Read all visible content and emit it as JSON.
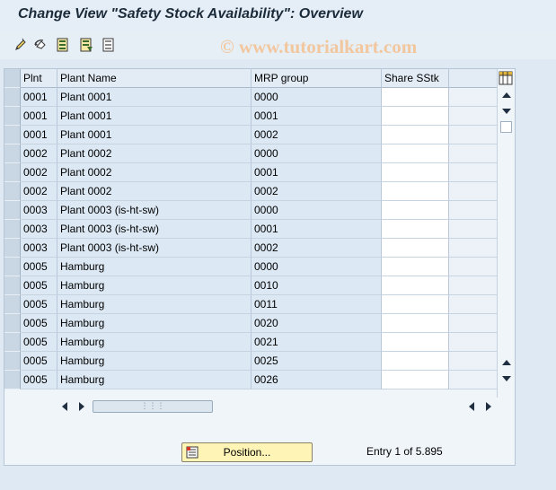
{
  "title": "Change View \"Safety Stock Availability\": Overview",
  "watermark": "© www.tutorialkart.com",
  "toolbar": {
    "icons": [
      "edit-pencil-icon",
      "undo-change-icon",
      "select-all-icon",
      "select-block-icon",
      "deselect-all-icon"
    ]
  },
  "table": {
    "columns": [
      "Plnt",
      "Plant Name",
      "MRP group",
      "Share SStk"
    ],
    "rows": [
      [
        "0001",
        "Plant 0001",
        "0000",
        ""
      ],
      [
        "0001",
        "Plant 0001",
        "0001",
        ""
      ],
      [
        "0001",
        "Plant 0001",
        "0002",
        ""
      ],
      [
        "0002",
        "Plant 0002",
        "0000",
        ""
      ],
      [
        "0002",
        "Plant 0002",
        "0001",
        ""
      ],
      [
        "0002",
        "Plant 0002",
        "0002",
        ""
      ],
      [
        "0003",
        "Plant 0003 (is-ht-sw)",
        "0000",
        ""
      ],
      [
        "0003",
        "Plant 0003 (is-ht-sw)",
        "0001",
        ""
      ],
      [
        "0003",
        "Plant 0003 (is-ht-sw)",
        "0002",
        ""
      ],
      [
        "0005",
        "Hamburg",
        "0000",
        ""
      ],
      [
        "0005",
        "Hamburg",
        "0010",
        ""
      ],
      [
        "0005",
        "Hamburg",
        "0011",
        ""
      ],
      [
        "0005",
        "Hamburg",
        "0020",
        ""
      ],
      [
        "0005",
        "Hamburg",
        "0021",
        ""
      ],
      [
        "0005",
        "Hamburg",
        "0025",
        ""
      ],
      [
        "0005",
        "Hamburg",
        "0026",
        ""
      ]
    ]
  },
  "footer": {
    "position_label": "Position...",
    "entry_text": "Entry 1 of 5.895"
  }
}
